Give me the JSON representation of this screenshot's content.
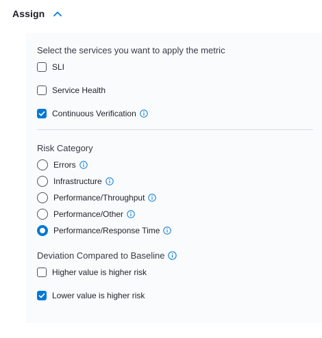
{
  "section": {
    "title": "Assign"
  },
  "services": {
    "label": "Select the services you want to apply the metric",
    "options": [
      {
        "label": "SLI",
        "checked": false,
        "info": false
      },
      {
        "label": "Service Health",
        "checked": false,
        "info": false
      },
      {
        "label": "Continuous Verification",
        "checked": true,
        "info": true
      }
    ]
  },
  "risk": {
    "label": "Risk Category",
    "options": [
      {
        "label": "Errors",
        "selected": false
      },
      {
        "label": "Infrastructure",
        "selected": false
      },
      {
        "label": "Performance/Throughput",
        "selected": false
      },
      {
        "label": "Performance/Other",
        "selected": false
      },
      {
        "label": "Performance/Response Time",
        "selected": true
      }
    ]
  },
  "deviation": {
    "label": "Deviation Compared to Baseline",
    "options": [
      {
        "label": "Higher value is higher risk",
        "checked": false
      },
      {
        "label": "Lower value is higher risk",
        "checked": true
      }
    ]
  },
  "colors": {
    "accent": "#0278d5",
    "panel_bg": "#fafbfc",
    "border": "#4b4f66"
  },
  "icons": {
    "collapse": "chevron-up-icon",
    "info": "info-icon",
    "check": "check-icon"
  }
}
